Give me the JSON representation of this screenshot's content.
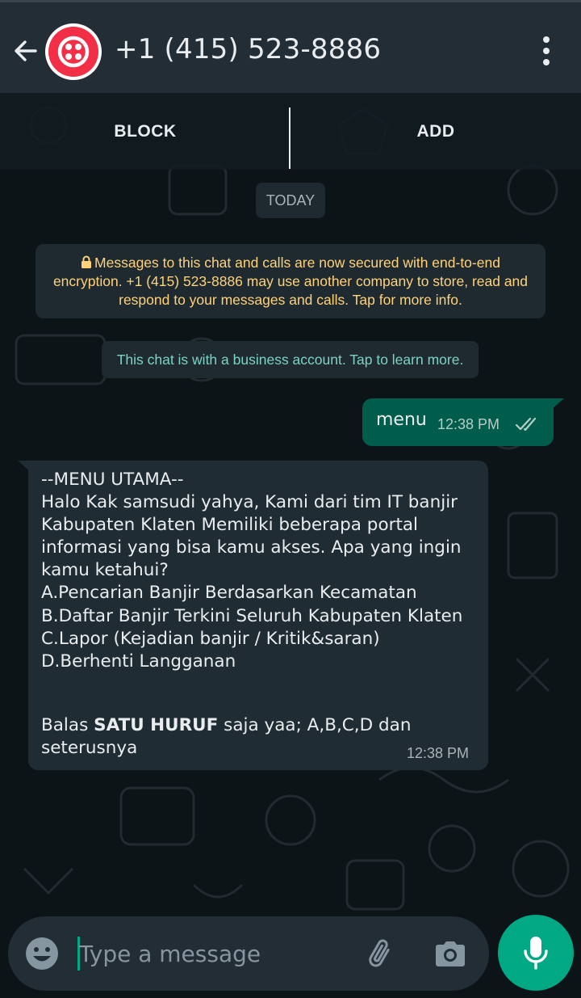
{
  "header": {
    "title": "+1 (415) 523-8886",
    "avatar_color": "#f22f46"
  },
  "actions": {
    "block_label": "BLOCK",
    "add_label": "ADD"
  },
  "chat": {
    "date_chip": "TODAY",
    "encryption_notice": "Messages to this chat and calls are now secured with end-to-end encryption. +1 (415) 523-8886 may use another company to store, read and respond to your messages and calls. Tap for more info.",
    "business_notice": "This chat is with a business account. Tap to learn more.",
    "messages": [
      {
        "direction": "outgoing",
        "text": "menu",
        "time": "12:38 PM",
        "status": "read"
      },
      {
        "direction": "incoming",
        "text": "--MENU UTAMA--\nHalo Kak samsudi yahya, Kami dari tim IT banjir Kabupaten Klaten Memiliki beberapa portal informasi yang bisa kamu akses. Apa yang ingin kamu ketahui?\nA.Pencarian Banjir Berdasarkan Kecamatan\nB.Daftar Banjir Terkini Seluruh Kabupaten Klaten\nC.Lapor (Kejadian banjir / Kritik&saran)\nD.Berhenti Langganan",
        "reply_prefix": "Balas ",
        "reply_bold": "SATU HURUF",
        "reply_suffix": " saja yaa; A,B,C,D dan seterusnya",
        "time": "12:38 PM"
      }
    ]
  },
  "composer": {
    "placeholder": "Type a message"
  },
  "icons": {
    "back": "arrow-left-icon",
    "menu": "more-vertical-icon",
    "lock": "lock-icon",
    "ticks": "double-check-icon",
    "emoji": "emoji-icon",
    "attach": "paperclip-icon",
    "camera": "camera-icon",
    "mic": "microphone-icon"
  },
  "colors": {
    "header_bg": "#232d36",
    "outgoing_bubble": "#005c4b",
    "incoming_bubble": "#202c33",
    "encryption_text": "#ffd279",
    "business_text": "#7ad3c5",
    "accent": "#00a884"
  }
}
